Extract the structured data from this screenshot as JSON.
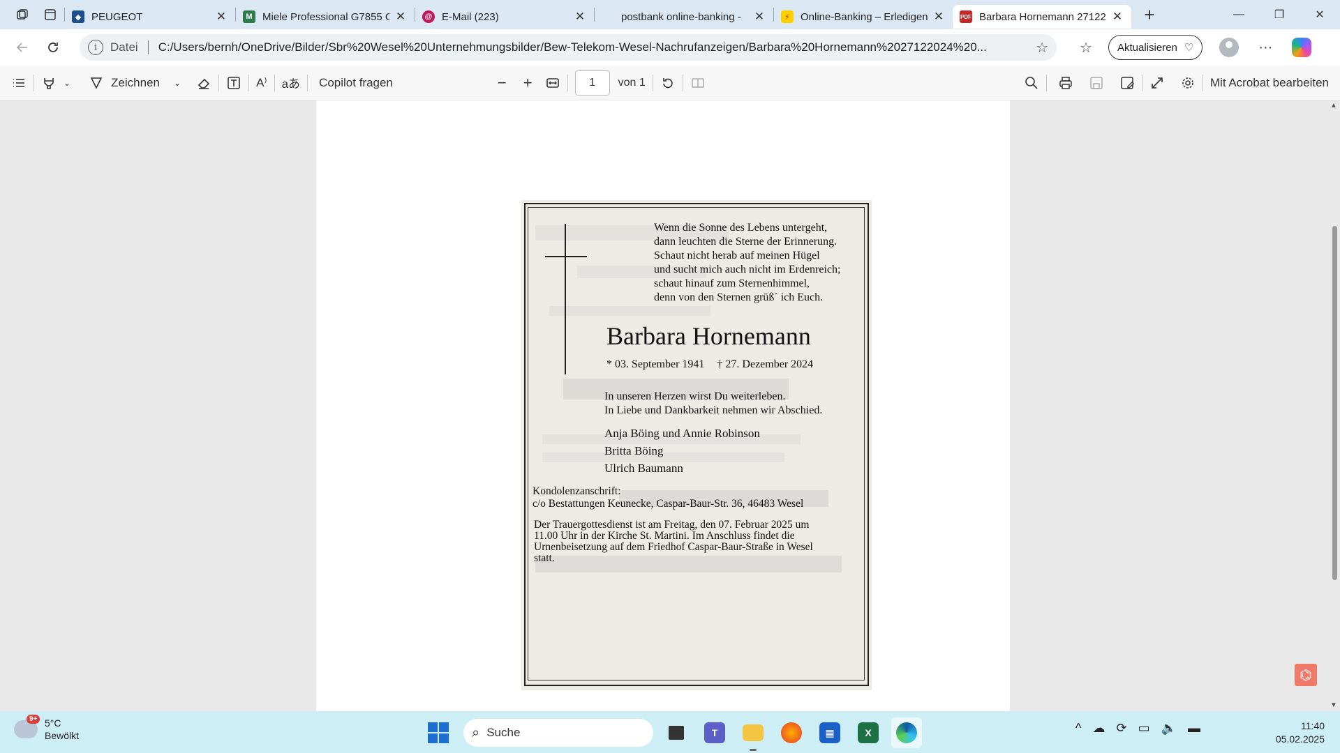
{
  "tabs": [
    {
      "title": "PEUGEOT",
      "favicon": "peugeot-icon",
      "color": "#1f4e8c",
      "active": false
    },
    {
      "title": "Miele Professional G7855 G",
      "favicon": "miele-icon",
      "color": "#2d7a4b",
      "active": false
    },
    {
      "title": "E-Mail (223)",
      "favicon": "email-icon",
      "color": "#c2185b",
      "active": false
    },
    {
      "title": "postbank online-banking -",
      "favicon": "postbank-icon",
      "color": "#fcd000",
      "active": false
    },
    {
      "title": "Online-Banking – Erledigen",
      "favicon": "postbank-icon",
      "color": "#fcd000",
      "active": false
    },
    {
      "title": "Barbara Hornemann 27122",
      "favicon": "pdf-icon",
      "color": "#c62828",
      "active": true
    }
  ],
  "address": {
    "scheme_label": "Datei",
    "url": "C:/Users/bernh/OneDrive/Bilder/Sbr%20Wesel%20Unternehmungsbilder/Bew-Telekom-Wesel-Nachrufanzeigen/Barbara%20Hornemann%2027122024%20...",
    "update_label": "Aktualisieren"
  },
  "pdf_toolbar": {
    "draw_label": "Zeichnen",
    "copilot_label": "Copilot fragen",
    "page_current": "1",
    "page_total": "von 1",
    "acrobat_label": "Mit Acrobat bearbeiten"
  },
  "notice": {
    "poem": [
      "Wenn die Sonne des Lebens untergeht,",
      "dann leuchten die Sterne der Erinnerung.",
      "Schaut nicht herab auf meinen Hügel",
      "und sucht mich auch nicht im Erdenreich;",
      "schaut hinauf zum Sternenhimmel,",
      "denn von den Sternen grüß´ ich Euch."
    ],
    "name": "Barbara Hornemann",
    "born": "* 03. September 1941",
    "died": "† 27. Dezember 2024",
    "memo": [
      "In unseren Herzen wirst Du weiterleben.",
      "In Liebe und Dankbarkeit nehmen wir Abschied."
    ],
    "family": [
      "Anja Böing und Annie Robinson",
      "Britta Böing",
      "Ulrich Baumann"
    ],
    "kondolenz_title": "Kondolenzanschrift:",
    "kondolenz_address": "c/o Bestattungen Keunecke, Caspar-Baur-Str. 36, 46483 Wesel",
    "service": [
      "Der Trauergottesdienst ist am Freitag, den 07. Februar 2025 um",
      "11.00 Uhr in der Kirche St. Martini. Im Anschluss findet die",
      "Urnenbeisetzung auf dem Friedhof Caspar-Baur-Straße in Wesel",
      "statt."
    ]
  },
  "taskbar": {
    "weather_temp": "5°C",
    "weather_desc": "Bewölkt",
    "weather_badge": "9+",
    "search_label": "Suche",
    "time": "11:40",
    "date": "05.02.2025"
  }
}
